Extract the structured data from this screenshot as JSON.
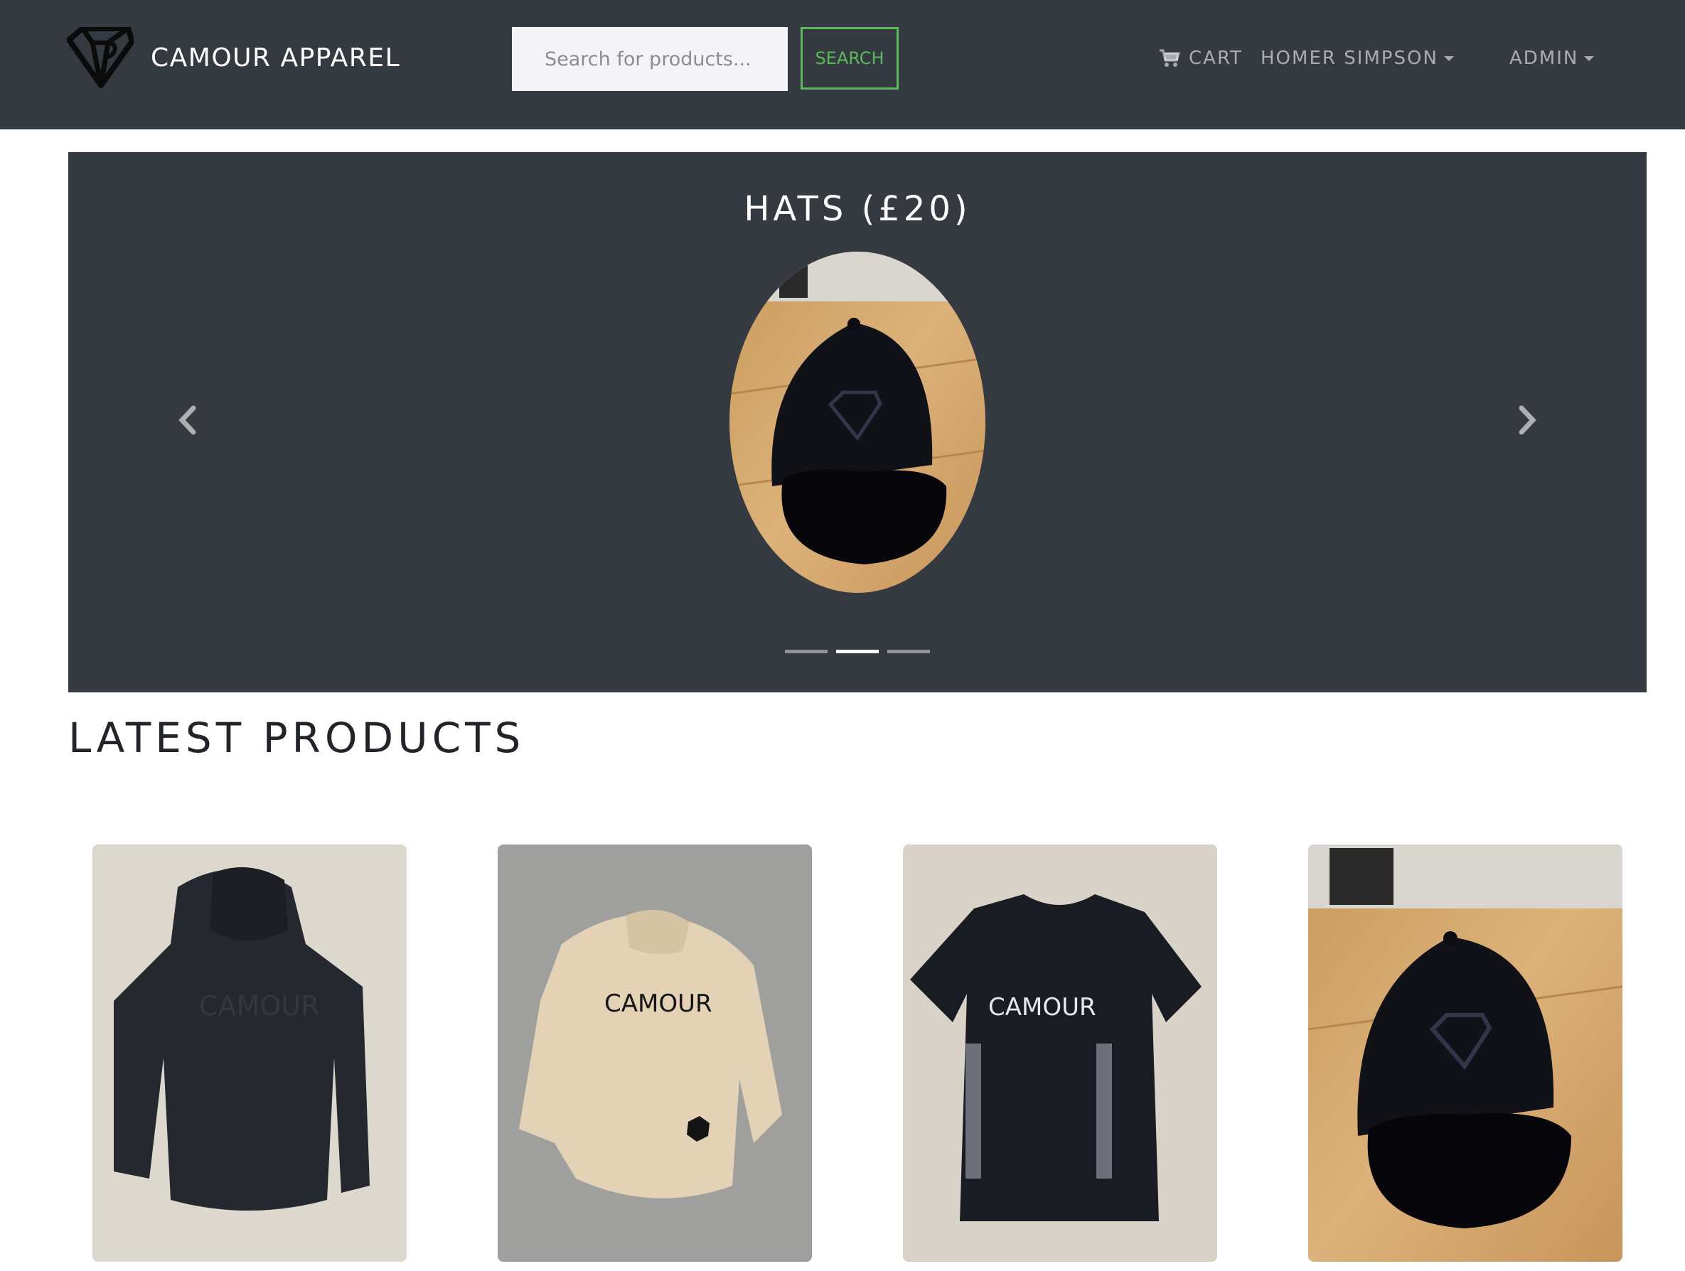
{
  "navbar": {
    "brand_name": "CAMOUR APPAREL",
    "logo_icon": "diamond-logo-icon",
    "search_placeholder": "Search for products...",
    "search_button": "SEARCH",
    "cart_label": "CART",
    "cart_icon": "shopping-cart-icon",
    "user_label": "HOMER SIMPSON",
    "admin_label": "ADMIN",
    "colors": {
      "background": "#343a40",
      "search_accent": "#5cb85c"
    }
  },
  "carousel": {
    "title": "HATS (£20)",
    "image": "black-baseball-cap-on-wooden-table",
    "prev_icon": "chevron-left-icon",
    "next_icon": "chevron-right-icon",
    "indicator_count": 3,
    "active_indicator": 2
  },
  "latest_products": {
    "heading": "LATEST PRODUCTS",
    "items": [
      {
        "image": "black-hoodie-with-ribbed-sleeves"
      },
      {
        "image": "beige-hoodie-camour-print"
      },
      {
        "image": "black-tshirt-camour-print"
      },
      {
        "image": "black-baseball-cap"
      }
    ]
  }
}
